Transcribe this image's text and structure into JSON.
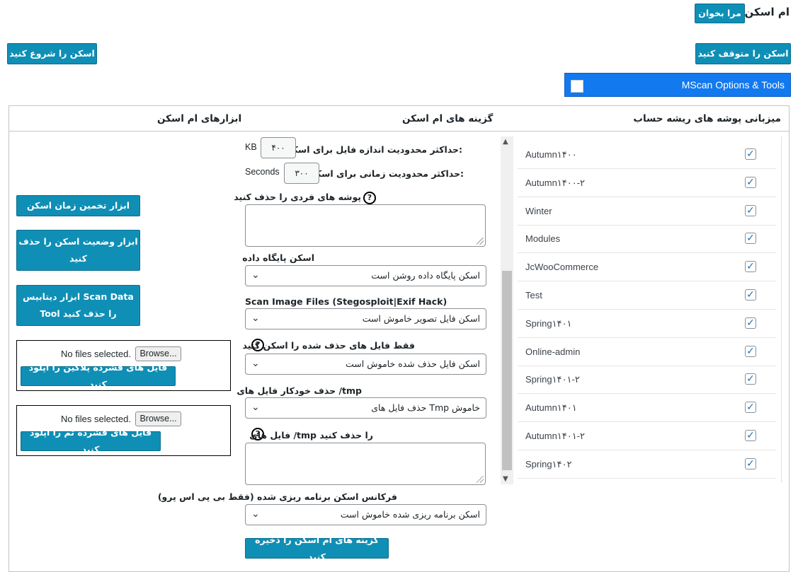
{
  "header": {
    "title": "ام اسکن",
    "read_me_button": "مرا بخوان",
    "stop_scan_button": "اسکن را متوقف کنید",
    "start_scan_button": "اسکن را شروع کنید",
    "options_bar_label": "MScan Options & Tools"
  },
  "columns": {
    "root_folders": "میزبانی پوشه های ریشه حساب",
    "options": "گزینه های ام اسکن",
    "tools": "ابزارهای ام اسکن"
  },
  "options": {
    "max_file_size_label": "حداکثر محدودیت اندازه فایل برای اسکن:",
    "max_file_size_value": "۴۰۰",
    "max_file_size_unit": "KB",
    "max_time_label": "حداکثر محدودیت زمانی برای اسکن:",
    "max_time_value": "۳۰۰",
    "max_time_unit": "Seconds",
    "exclude_folders_label": "پوشه های فردی را حذف کنید",
    "db_scan_label": "اسکن پایگاه داده",
    "db_scan_value": "اسکن پایگاه داده روشن است",
    "image_scan_label": "Scan Image Files (Stegosploit|Exif Hack)",
    "image_scan_value": "اسکن فایل تصویر خاموش است",
    "deleted_scan_label": "فقط فایل های حذف شده را اسکن کنید",
    "deleted_scan_value": "اسکن فایل حذف شده خاموش است",
    "tmp_autodelete_label": "حذف خودکار فایل های /tmp",
    "tmp_autodelete_value": "حذف فایل های Tmp خاموش",
    "tmp_exclude_label": "فایل های /tmp را حذف کنید",
    "schedule_label": "فرکانس اسکن برنامه ریزی شده (فقط بی پی اس پرو)",
    "schedule_value": "اسکن برنامه ریزی شده خاموش است",
    "save_button": "گزینه های ام اسکن را ذخیره کنید",
    "help_glyph": "?"
  },
  "tools": {
    "estimate_button": "ابزار تخمین زمان اسکن",
    "delete_status_line1": "ابزار وضعیت اسکن را حذف",
    "delete_status_line2": "کنید",
    "delete_data_line1": "ابزار دیتابیس Scan Data",
    "delete_data_line2": "Tool را حذف کنید",
    "no_files_1": "No files selected.",
    "browse_1": "Browse...",
    "upload_plugin_button": "فایل های فشرده پلاگین را آپلود کنید",
    "no_files_2": "No files selected.",
    "browse_2": "Browse...",
    "upload_theme_button": "فایل های فشرده تم را آپلود کنید"
  },
  "folders": [
    {
      "name": "Autumn۱۴۰۰",
      "checked": true
    },
    {
      "name": "Autumn۱۴۰۰-۲",
      "checked": true
    },
    {
      "name": "Winter",
      "checked": true
    },
    {
      "name": "Modules",
      "checked": true
    },
    {
      "name": "JcWooCommerce",
      "checked": true
    },
    {
      "name": "Test",
      "checked": true
    },
    {
      "name": "Spring۱۴۰۱",
      "checked": true
    },
    {
      "name": "Online-admin",
      "checked": true
    },
    {
      "name": "Spring۱۴۰۱-۲",
      "checked": true
    },
    {
      "name": "Autumn۱۴۰۱",
      "checked": true
    },
    {
      "name": "Autumn۱۴۰۱-۲",
      "checked": true
    },
    {
      "name": "Spring۱۴۰۲",
      "checked": true
    }
  ],
  "icons": {
    "checkmark": "check-icon",
    "dropdown": "chevron-down-icon",
    "help": "help-circle-icon"
  },
  "colors": {
    "button": "#0f8fb6",
    "bar": "#1279ef",
    "check": "#2271b1"
  }
}
